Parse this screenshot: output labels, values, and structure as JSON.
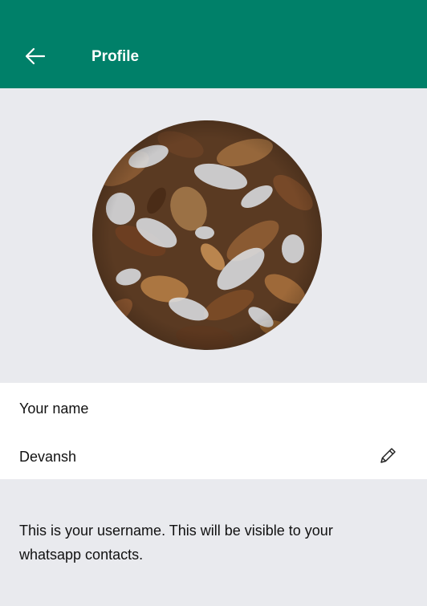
{
  "header": {
    "title": "Profile",
    "back_icon": "arrow-left-icon",
    "background": "#008069"
  },
  "profile_photo": {
    "description_icon": "avatar"
  },
  "name_section": {
    "label": "Your name",
    "value": "Devansh",
    "edit_icon": "pencil-icon"
  },
  "info": {
    "text": "This is your username. This will be visible to your whatsapp contacts."
  }
}
